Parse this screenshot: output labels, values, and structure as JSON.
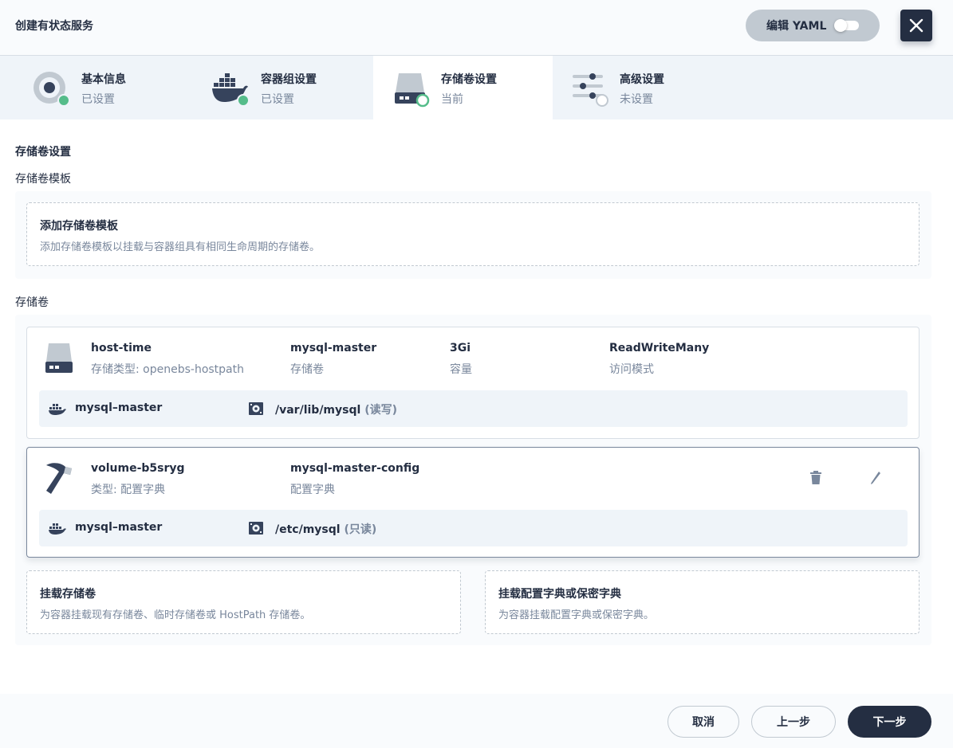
{
  "header": {
    "title": "创建有状态服务",
    "yaml_label": "编辑 YAML"
  },
  "steps": [
    {
      "title": "基本信息",
      "status": "已设置",
      "icon": "disc-icon"
    },
    {
      "title": "容器组设置",
      "status": "已设置",
      "icon": "docker-icon"
    },
    {
      "title": "存储卷设置",
      "status": "当前",
      "icon": "storage-icon"
    },
    {
      "title": "高级设置",
      "status": "未设置",
      "icon": "sliders-icon"
    }
  ],
  "main": {
    "section_title": "存储卷设置",
    "template_label": "存储卷模板",
    "add_template": {
      "title": "添加存储卷模板",
      "desc": "添加存储卷模板以挂载与容器组具有相同生命周期的存储卷。"
    },
    "volumes_label": "存储卷",
    "volumes": [
      {
        "name": "host-time",
        "type": "存储类型: openebs-hostpath",
        "col2_main": "mysql-master",
        "col2_sub": "存储卷",
        "col3_main": "3Gi",
        "col3_sub": "容量",
        "col4_main": "ReadWriteMany",
        "col4_sub": "访问模式",
        "mount": {
          "container": "mysql–master",
          "path": "/var/lib/mysql",
          "mode": "(读写)"
        }
      },
      {
        "name": "volume-b5sryg",
        "type": "类型: 配置字典",
        "col2_main": "mysql-master-config",
        "col2_sub": "配置字典",
        "mount": {
          "container": "mysql–master",
          "path": "/etc/mysql",
          "mode": "(只读)"
        }
      }
    ],
    "mount_volume": {
      "title": "挂载存储卷",
      "desc": "为容器挂载现有存储卷、临时存储卷或 HostPath 存储卷。"
    },
    "mount_config": {
      "title": "挂载配置字典或保密字典",
      "desc": "为容器挂载配置字典或保密字典。"
    }
  },
  "footer": {
    "cancel": "取消",
    "prev": "上一步",
    "next": "下一步"
  },
  "colors": {
    "primary": "#242e42",
    "success": "#55bc8a",
    "muted": "#79879c",
    "border": "#d8dee5"
  }
}
